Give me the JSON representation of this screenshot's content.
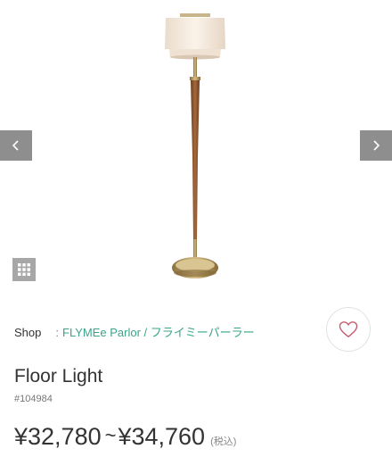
{
  "gallery": {
    "image_alt": "Floor Light",
    "prev_icon": "chevron-left-icon",
    "next_icon": "chevron-right-icon",
    "grid_icon": "grid-icon"
  },
  "shop": {
    "label": "Shop",
    "separator": ":",
    "name": "FLYMEe Parlor / フライミーパーラー"
  },
  "favorite": {
    "icon": "heart-icon",
    "color": "#c2566b"
  },
  "product": {
    "title": "Floor Light",
    "sku": "#104984",
    "price_from": "¥32,780",
    "tilde": "~",
    "price_to": "¥34,760",
    "tax_note": "(税込)"
  },
  "colors": {
    "accent": "#3aa58a",
    "nav_bg": "#8e8e8e"
  }
}
